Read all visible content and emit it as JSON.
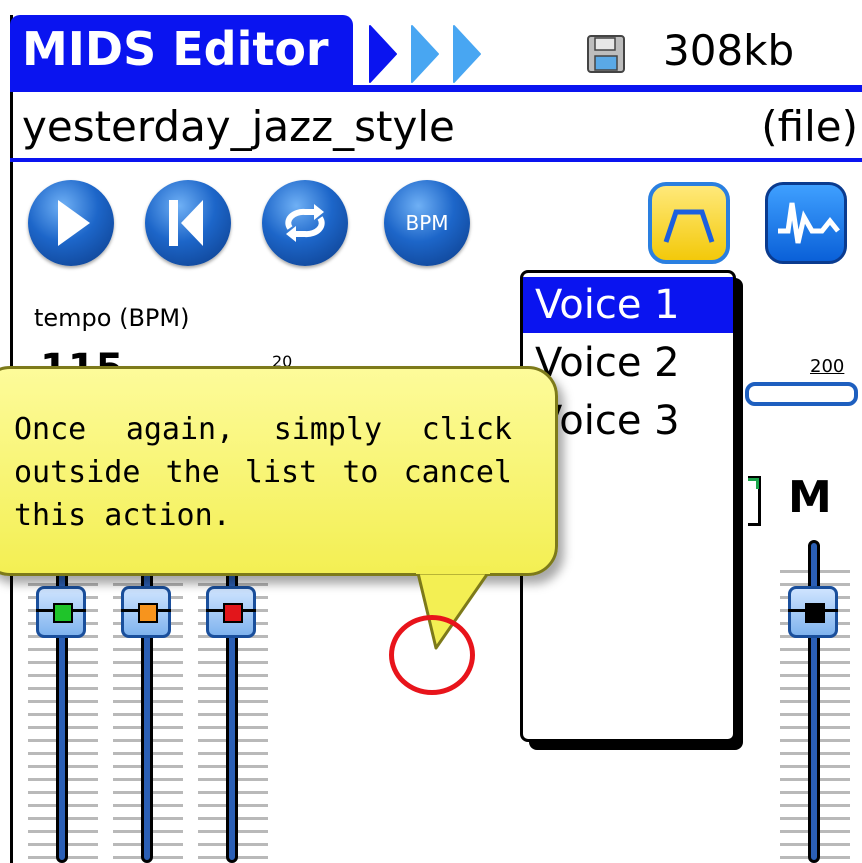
{
  "header": {
    "app_title": "MIDS Editor",
    "memory": "308kb"
  },
  "file": {
    "name": "yesterday_jazz_style",
    "tag": "(file)"
  },
  "toolbar": {
    "bpm_label": "BPM"
  },
  "tempo": {
    "label": "tempo (BPM)",
    "value": "115",
    "min_tick": "20",
    "max_tick": "200"
  },
  "mixer": {
    "master_label": "M",
    "channel_colors": [
      "#1fc42a",
      "#f7941d",
      "#e2161b",
      "#000000"
    ]
  },
  "voice_list": {
    "items": [
      "Voice 1",
      "Voice 2",
      "Voice 3"
    ],
    "selected_index": 0
  },
  "tooltip": {
    "text": "Once again, simply click outside the list to cancel this action."
  },
  "colors": {
    "accent": "#0a14f0",
    "tooltip_bg": "#f6f25c",
    "annotation": "#e8141b"
  }
}
